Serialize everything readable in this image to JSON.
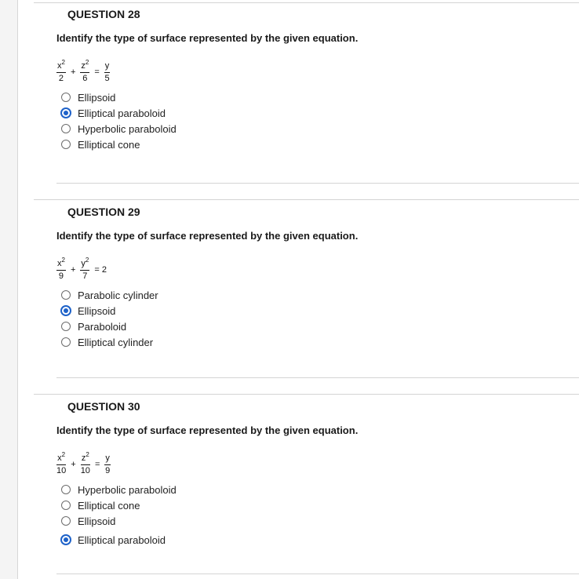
{
  "questions": [
    {
      "header": "QUESTION 28",
      "prompt": "Identify the type of surface represented by the given equation.",
      "equation": {
        "terms": [
          {
            "num": "x",
            "exp": "2",
            "den": "2"
          },
          {
            "op": "+"
          },
          {
            "num": "z",
            "exp": "2",
            "den": "6"
          },
          {
            "op": "="
          },
          {
            "num": "y",
            "exp": "",
            "den": "5"
          }
        ]
      },
      "options": [
        {
          "label": "Ellipsoid",
          "selected": false
        },
        {
          "label": "Elliptical paraboloid",
          "selected": true
        },
        {
          "label": "Hyperbolic paraboloid",
          "selected": false
        },
        {
          "label": "Elliptical cone",
          "selected": false
        }
      ]
    },
    {
      "header": "QUESTION 29",
      "prompt": "Identify the type of surface represented by the given equation.",
      "equation": {
        "terms": [
          {
            "num": "x",
            "exp": "2",
            "den": "9"
          },
          {
            "op": "+"
          },
          {
            "num": "y",
            "exp": "2",
            "den": "7"
          },
          {
            "op": "= 2"
          }
        ]
      },
      "options": [
        {
          "label": "Parabolic cylinder",
          "selected": false
        },
        {
          "label": "Ellipsoid",
          "selected": true
        },
        {
          "label": "Paraboloid",
          "selected": false
        },
        {
          "label": "Elliptical cylinder",
          "selected": false
        }
      ]
    },
    {
      "header": "QUESTION 30",
      "prompt": "Identify the type of surface represented by the given equation.",
      "equation": {
        "terms": [
          {
            "num": "x",
            "exp": "2",
            "den": "10"
          },
          {
            "op": "+"
          },
          {
            "num": "z",
            "exp": "2",
            "den": "10"
          },
          {
            "op": "="
          },
          {
            "num": "y",
            "exp": "",
            "den": "9"
          }
        ]
      },
      "options": [
        {
          "label": "Hyperbolic paraboloid",
          "selected": false
        },
        {
          "label": "Elliptical cone",
          "selected": false
        },
        {
          "label": "Ellipsoid",
          "selected": false
        },
        {
          "label": "Elliptical paraboloid",
          "selected": true
        }
      ]
    }
  ],
  "colors": {
    "accent": "#1e62c9",
    "rule": "#d4d4d4",
    "rail": "#f4f4f4"
  }
}
